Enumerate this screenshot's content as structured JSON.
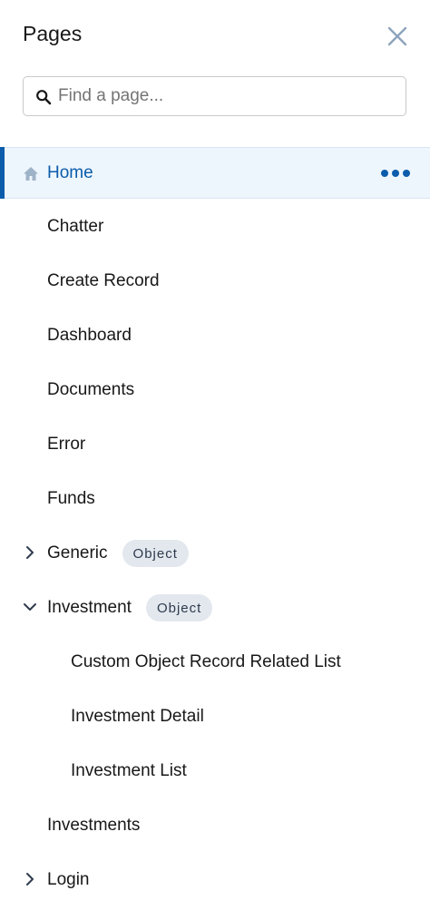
{
  "header": {
    "title": "Pages",
    "close_icon": "close-icon"
  },
  "search": {
    "placeholder": "Find a page...",
    "value": "",
    "icon": "search-icon"
  },
  "colors": {
    "accent": "#0b5cab",
    "active_bg": "#eef6fd",
    "badge_bg": "#e3e8ee"
  },
  "pages": {
    "home": {
      "label": "Home",
      "icon": "home-icon",
      "more_icon": "more-options-icon"
    },
    "chatter": {
      "label": "Chatter"
    },
    "create_record": {
      "label": "Create Record"
    },
    "dashboard": {
      "label": "Dashboard"
    },
    "documents": {
      "label": "Documents"
    },
    "error": {
      "label": "Error"
    },
    "funds": {
      "label": "Funds"
    },
    "generic": {
      "label": "Generic",
      "badge": "Object",
      "expanded": false
    },
    "investment": {
      "label": "Investment",
      "badge": "Object",
      "expanded": true
    },
    "custom_object_related_list": {
      "label": "Custom Object Record Related List"
    },
    "investment_detail": {
      "label": "Investment Detail"
    },
    "investment_list": {
      "label": "Investment List"
    },
    "investments": {
      "label": "Investments"
    },
    "login": {
      "label": "Login",
      "expanded": false
    }
  }
}
